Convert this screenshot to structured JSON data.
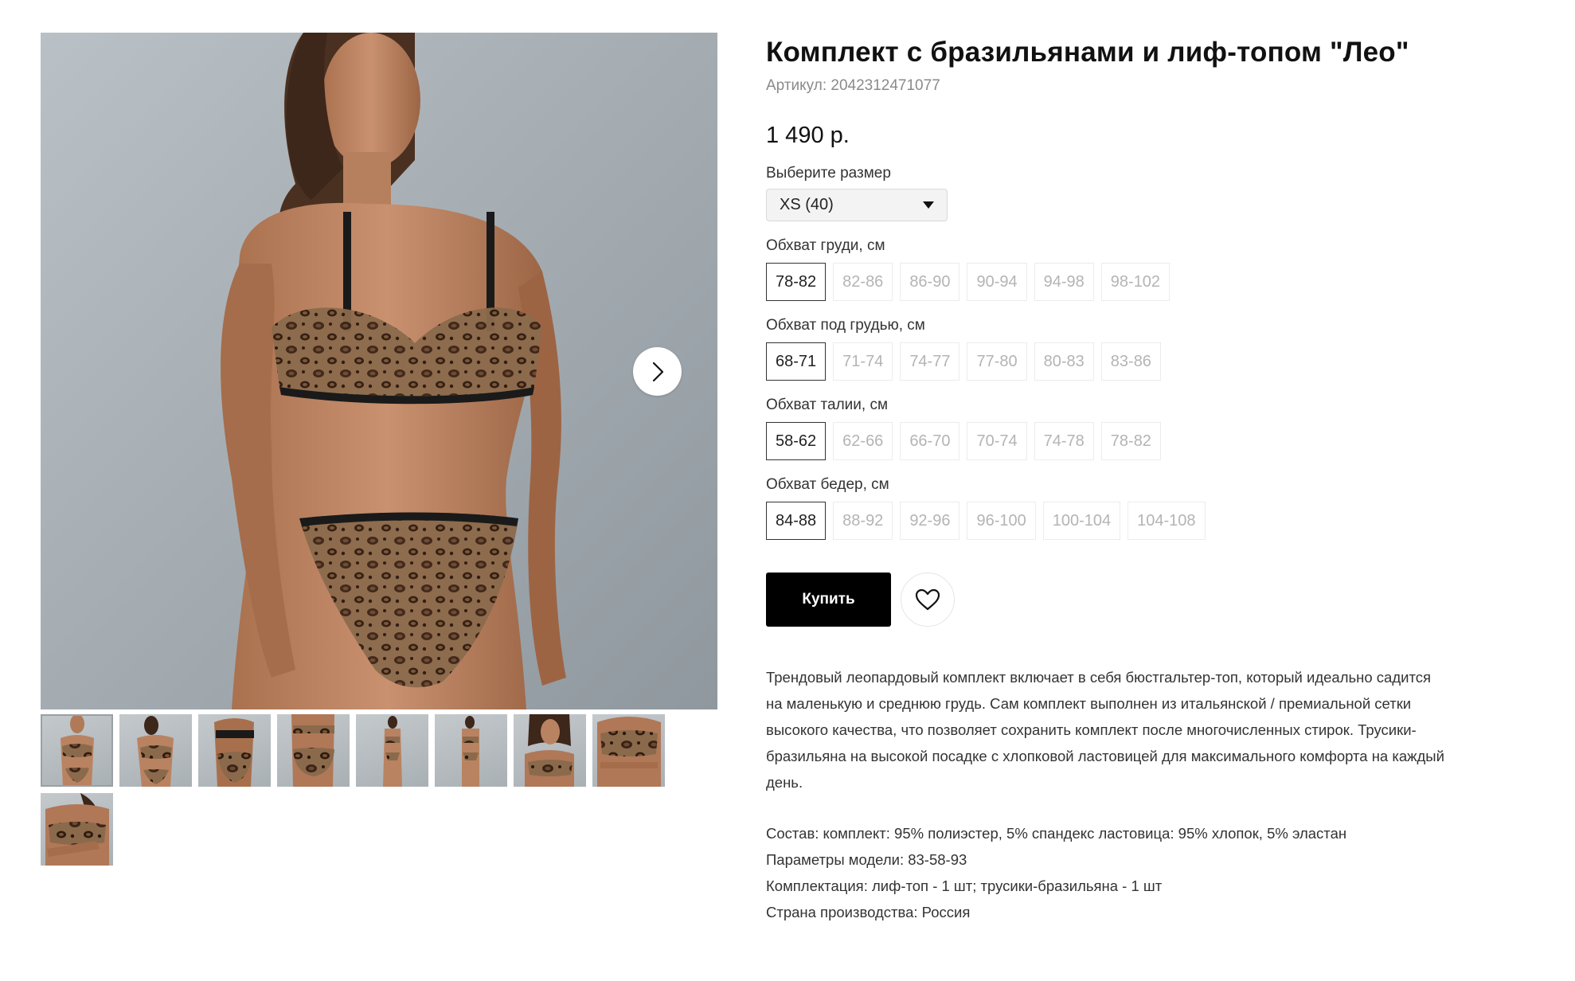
{
  "product": {
    "title": "Комплект с бразильянами и лиф-топом \"Лео\"",
    "sku": "Артикул: 2042312471077",
    "price": "1 490 р."
  },
  "size_select": {
    "label": "Выберите размер",
    "selected": "XS (40)"
  },
  "measurements": [
    {
      "label": "Обхват груди, см",
      "options": [
        "78-82",
        "82-86",
        "86-90",
        "90-94",
        "94-98",
        "98-102"
      ],
      "active": 0
    },
    {
      "label": "Обхват под грудью, см",
      "options": [
        "68-71",
        "71-74",
        "74-77",
        "77-80",
        "80-83",
        "83-86"
      ],
      "active": 0
    },
    {
      "label": "Обхват талии, см",
      "options": [
        "58-62",
        "62-66",
        "66-70",
        "70-74",
        "74-78",
        "78-82"
      ],
      "active": 0
    },
    {
      "label": "Обхват бедер, см",
      "options": [
        "84-88",
        "88-92",
        "92-96",
        "96-100",
        "100-104",
        "104-108"
      ],
      "active": 0
    }
  ],
  "actions": {
    "buy_label": "Купить",
    "favorite_icon": "heart-icon"
  },
  "gallery": {
    "next_icon": "chevron-right-icon",
    "thumbnail_count": 9,
    "active_thumbnail": 0
  },
  "description": "Трендовый леопардовый комплект включает в себя бюстгальтер-топ, который идеально садится на маленькую и среднюю грудь. Сам комплект выполнен из итальянской / премиальной сетки высокого качества, что позволяет сохранить комплект после многочисленных стирок. Трусики-бразильяна на высокой посадке с хлопковой ластовицей для максимального комфорта на каждый день.",
  "specs": [
    "Состав: комплект: 95% полиэстер, 5% спандекс ластовица: 95% хлопок, 5% эластан",
    "Параметры модели: 83-58-93",
    "Комплектация: лиф-топ - 1 шт; трусики-бразильяна - 1 шт",
    "Страна производства: Россия"
  ],
  "colors": {
    "accent": "#000000",
    "muted_text": "#8a8a8a",
    "chip_inactive_text": "#b4b4b4",
    "photo_background": "#a8b0b6"
  }
}
